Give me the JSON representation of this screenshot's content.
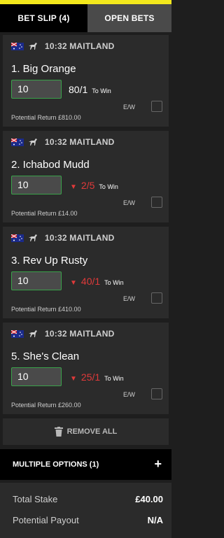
{
  "tabs": {
    "bet_slip": "BET SLIP (4)",
    "open_bets": "OPEN BETS"
  },
  "bets": [
    {
      "race": "10:32 MAITLAND",
      "selection": "1. Big Orange",
      "stake": "10",
      "odds": "80/1",
      "drifting": false,
      "to_win": "To Win",
      "ew": "E/W",
      "potential_return": "Potential Return  £810.00"
    },
    {
      "race": "10:32 MAITLAND",
      "selection": "2. Ichabod Mudd",
      "stake": "10",
      "odds": "2/5",
      "drifting": true,
      "to_win": "To Win",
      "ew": "E/W",
      "potential_return": "Potential Return  £14.00"
    },
    {
      "race": "10:32 MAITLAND",
      "selection": "3. Rev Up Rusty",
      "stake": "10",
      "odds": "40/1",
      "drifting": true,
      "to_win": "To Win",
      "ew": "E/W",
      "potential_return": "Potential Return  £410.00"
    },
    {
      "race": "10:32 MAITLAND",
      "selection": "5. She's Clean",
      "stake": "10",
      "odds": "25/1",
      "drifting": true,
      "to_win": "To Win",
      "ew": "E/W",
      "potential_return": "Potential Return  £260.00"
    }
  ],
  "remove_all": "REMOVE ALL",
  "multiple_options": "MULTIPLE OPTIONS (1)",
  "plus_icon": "+",
  "totals": {
    "stake_label": "Total Stake",
    "stake_value": "£40.00",
    "payout_label": "Potential Payout",
    "payout_value": "N/A"
  },
  "colors": {
    "accent": "#f3e81c",
    "odds_drift": "#e03a3a",
    "input_border": "#3aa24a"
  }
}
